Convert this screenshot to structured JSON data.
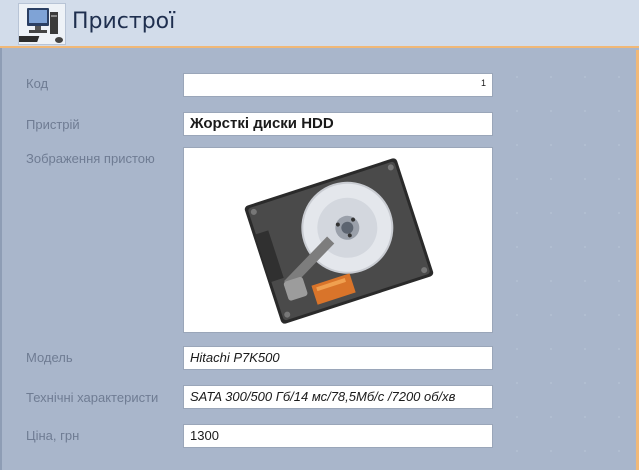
{
  "header": {
    "title": "Пристрої",
    "icon": "computer-icon"
  },
  "form": {
    "code_label": "Код",
    "code_value": "1",
    "device_label": "Пристрій",
    "device_value": "Жорсткі диски HDD",
    "image_label": "Зображення пристою",
    "image_subject": "hard-disk-drive-icon",
    "model_label": "Модель",
    "model_value": "Hitachi P7K500",
    "specs_label": "Технічні характеристи",
    "specs_value": "SATA 300/500 Гб/14 мс/78,5Мб/с /7200 об/хв",
    "price_label": "Ціна, грн",
    "price_value": "1300"
  },
  "colors": {
    "background": "#a9b6cb",
    "header": "#d2dcea",
    "accent_border": "#f0b878",
    "label": "#6f7c93"
  }
}
